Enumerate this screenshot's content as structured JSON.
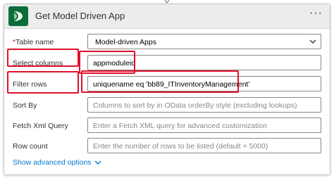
{
  "header": {
    "title": "Get Model Driven App",
    "more_label": "···",
    "icon": "dataverse-icon",
    "accent_color": "#0a6e3a"
  },
  "fields": {
    "table_name": {
      "label": "Table name",
      "required": true,
      "value": "Model-driven Apps"
    },
    "select_columns": {
      "label": "Select columns",
      "value": "appmoduleid"
    },
    "filter_rows": {
      "label": "Filter rows",
      "value": "uniquename eq 'bb89_ITInventoryManagement'"
    },
    "sort_by": {
      "label": "Sort By",
      "placeholder": "Columns to sort by in OData orderBy style (excluding lookups)"
    },
    "fetch_xml": {
      "label": "Fetch Xml Query",
      "placeholder": "Enter a Fetch XML query for advanced customization"
    },
    "row_count": {
      "label": "Row count",
      "placeholder": "Enter the number of rows to be listed (default = 5000)"
    }
  },
  "advanced_options": {
    "label": "Show advanced options"
  },
  "colors": {
    "highlight": "#e0102d",
    "link": "#0078d4"
  }
}
